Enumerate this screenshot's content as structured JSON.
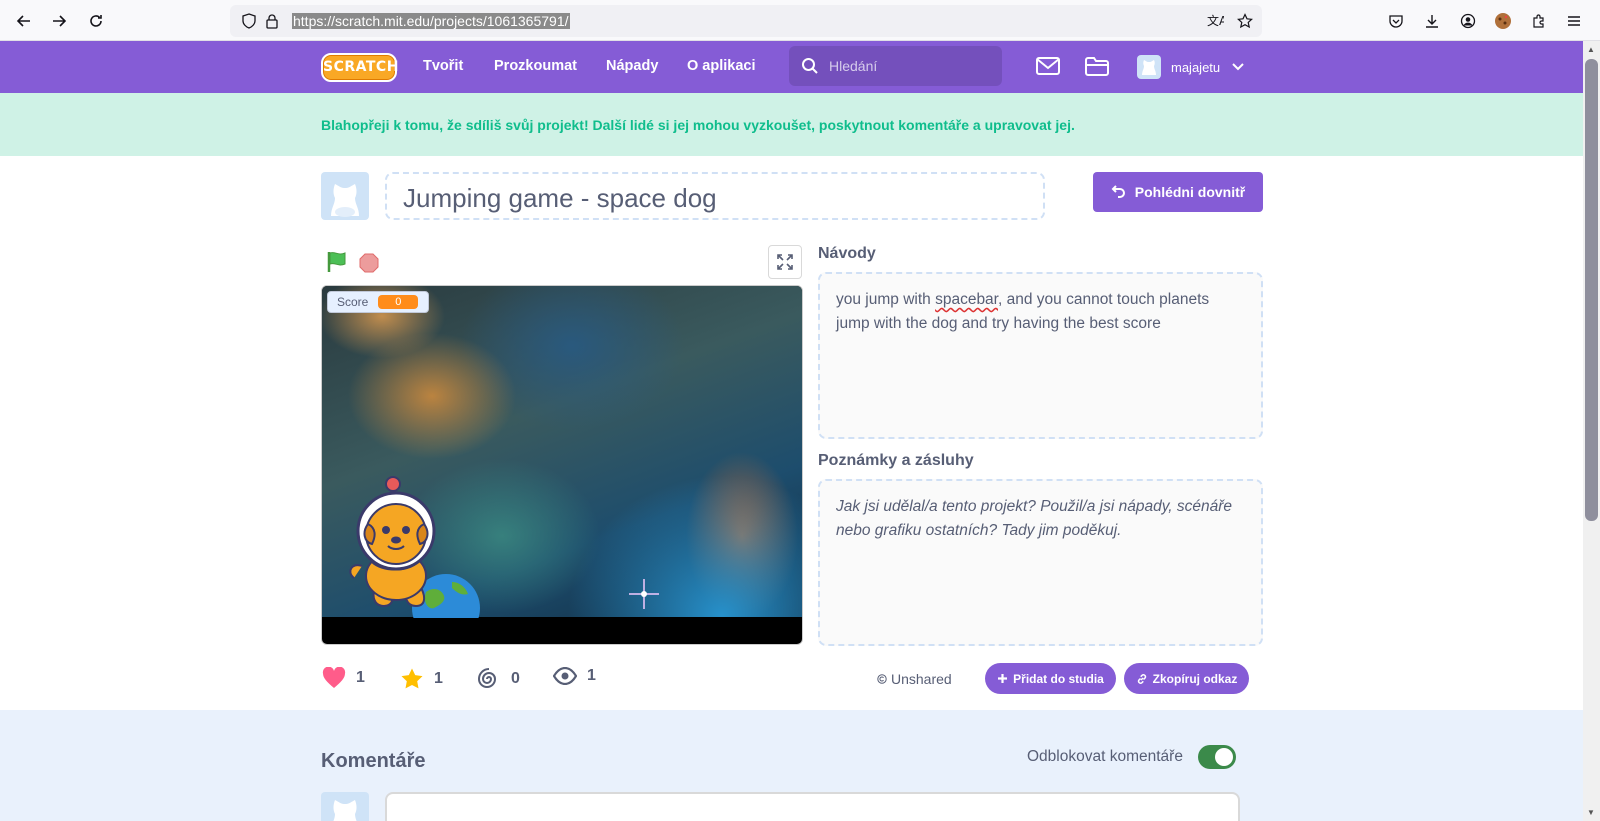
{
  "browser": {
    "url": "https://scratch.mit.edu/projects/1061365791/"
  },
  "nav": {
    "logo": "SCRATCH",
    "links": [
      "Tvořit",
      "Prozkoumat",
      "Nápady",
      "O aplikaci"
    ],
    "search_placeholder": "Hledání",
    "username": "majajetu",
    "brand_color": "#855cd6"
  },
  "banner": {
    "text": "Blahopřeji k tomu, že sdíliš svůj projekt! Další lidé si jej mohou vyzkoušet, poskytnout komentáře a upravovat jej."
  },
  "project": {
    "title": "Jumping game - space dog",
    "see_inside_label": "Pohlédni dovnitř",
    "monitor_label": "Score",
    "monitor_value": "0"
  },
  "instructions": {
    "heading": "Návody",
    "line1_before": "you jump with ",
    "line1_misspelled": "spacebar",
    "line1_after": ", and you cannot touch planets",
    "line2": "jump with the dog and try having the best score"
  },
  "notes": {
    "heading": "Poznámky a zásluhy",
    "placeholder": "Jak jsi udělal/a tento projekt? Použil/a jsi nápady, scénáře nebo grafiku ostatních? Tady jim poděkuj."
  },
  "stats": {
    "loves": "1",
    "favorites": "1",
    "remixes": "0",
    "views": "1"
  },
  "actions": {
    "unshared": "Unshared",
    "add_to_studio": "Přidat do studia",
    "copy_link": "Zkopíruj odkaz"
  },
  "comments": {
    "title": "Komentáře",
    "toggle_label": "Odblokovat komentáře",
    "toggle_on": true
  }
}
